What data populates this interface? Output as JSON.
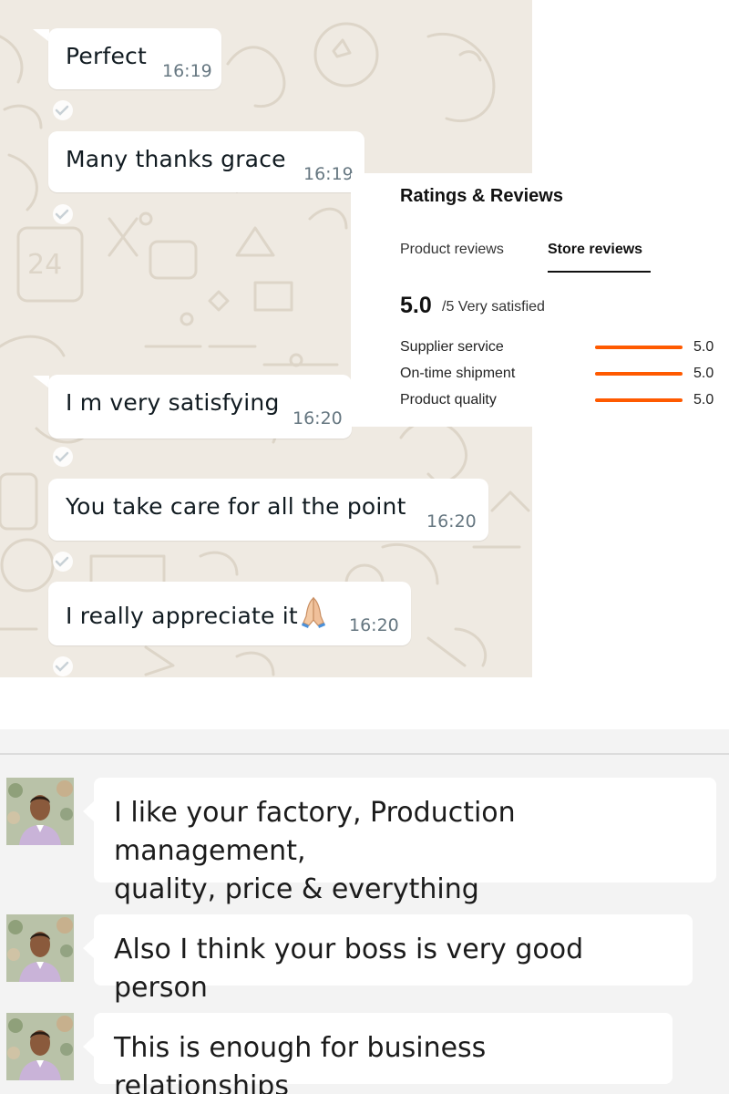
{
  "whatsapp": {
    "messages": [
      {
        "text": "Perfect",
        "time": "16:19",
        "read_icon": "double-check-icon"
      },
      {
        "text": "Many thanks grace",
        "time": "16:19",
        "read_icon": "double-check-icon"
      },
      {
        "text": "I m very satisfying",
        "time": "16:20",
        "read_icon": "double-check-icon"
      },
      {
        "text": "You take care for all the point",
        "time": "16:20",
        "read_icon": "double-check-icon"
      },
      {
        "text": "I really appreciate it",
        "emoji": "folded-hands-emoji",
        "time": "16:20",
        "read_icon": "double-check-icon"
      }
    ],
    "colors": {
      "background": "#efeae2",
      "bubble": "#ffffff",
      "time": "#667781"
    }
  },
  "ratings": {
    "title": "Ratings & Reviews",
    "tabs": [
      {
        "label": "Product reviews",
        "active": false
      },
      {
        "label": "Store reviews",
        "active": true
      }
    ],
    "score": "5.0",
    "score_suffix": "/5 Very satisfied",
    "metrics": [
      {
        "label": "Supplier service",
        "value": "5.0",
        "fraction": 1.0
      },
      {
        "label": "On-time shipment",
        "value": "5.0",
        "fraction": 1.0
      },
      {
        "label": "Product quality",
        "value": "5.0",
        "fraction": 1.0
      }
    ],
    "accent_color": "#ff5a00"
  },
  "chat2": {
    "messages": [
      {
        "lines": [
          "I like your factory, Production management,",
          "quality, price & everything"
        ],
        "avatar": "user-avatar"
      },
      {
        "lines": [
          "Also I think your boss is very good person"
        ],
        "avatar": "user-avatar"
      },
      {
        "lines": [
          "This is enough for business relationships"
        ],
        "avatar": "user-avatar"
      }
    ],
    "colors": {
      "background": "#f3f3f3",
      "bubble": "#ffffff"
    }
  }
}
